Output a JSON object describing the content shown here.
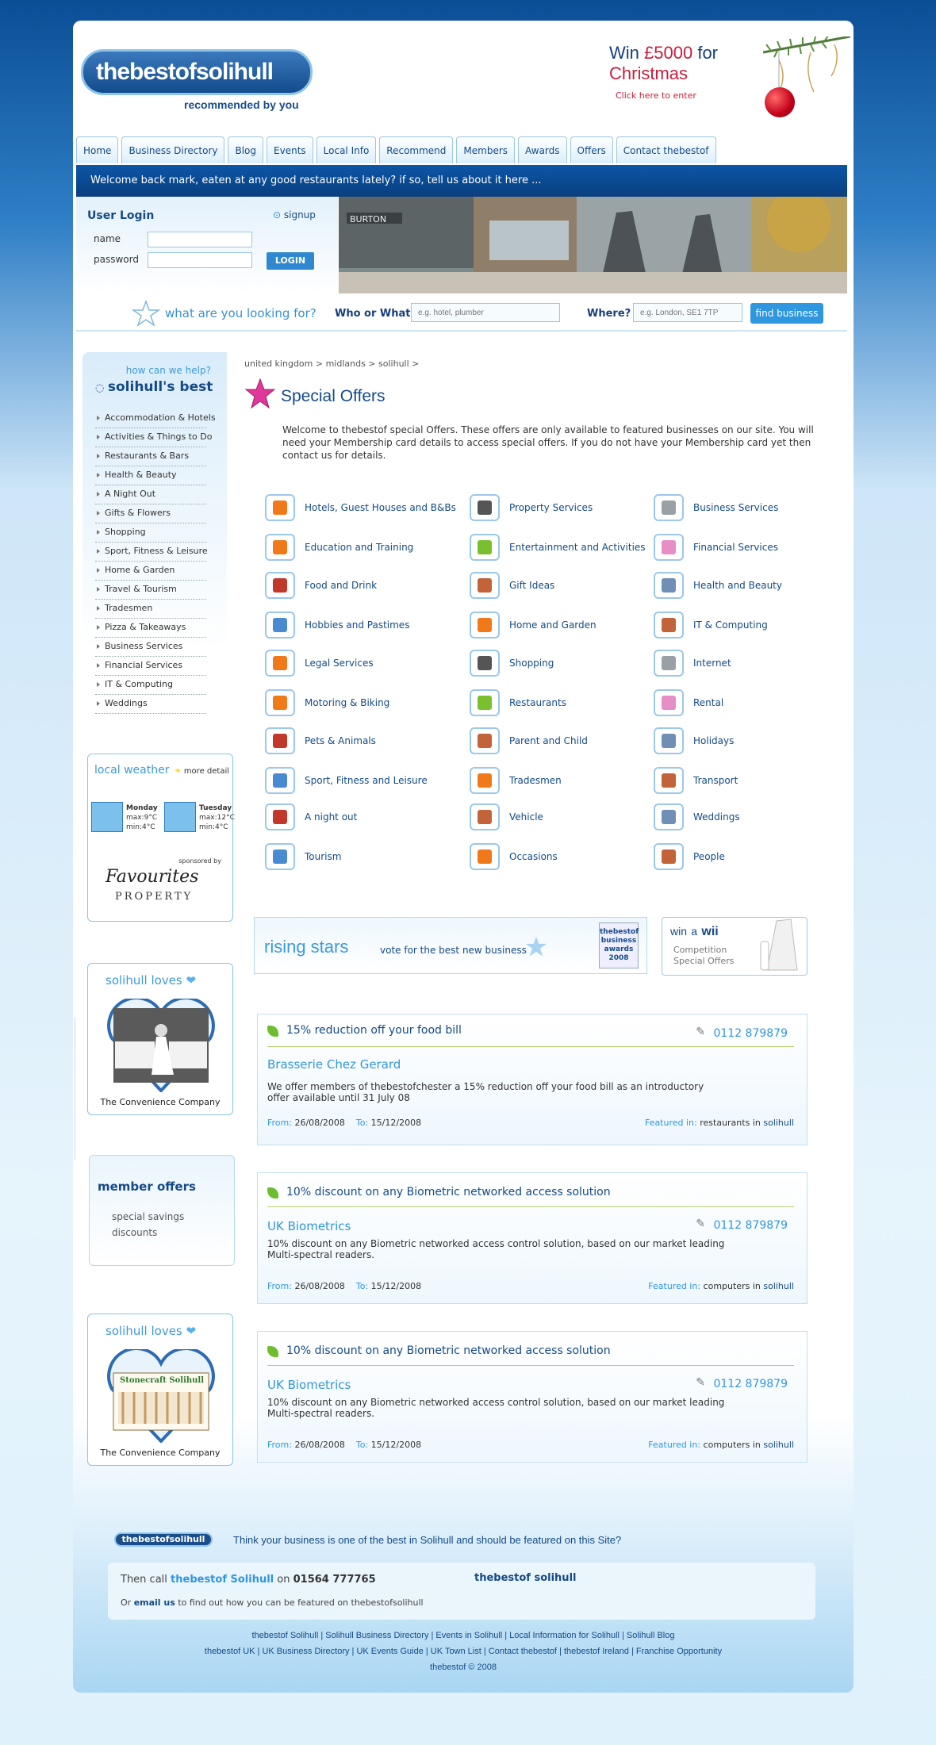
{
  "header": {
    "logo": "thebestofsolihull",
    "tagline": "recommended by you",
    "promo_line1_a": "Win",
    "promo_line1_b": "£5000",
    "promo_line1_c": "for",
    "promo_line2": "Christmas",
    "promo_link": "Click here to enter"
  },
  "nav": [
    "Home",
    "Business Directory",
    "Blog",
    "Events",
    "Local Info",
    "Recommend",
    "Members",
    "Awards",
    "Offers",
    "Contact thebestof"
  ],
  "welcome": "Welcome back mark, eaten at any good restaurants lately? if so, tell us about it here ...",
  "login": {
    "title": "User Login",
    "signup": "signup",
    "name_label": "name",
    "password_label": "password",
    "button": "LOGIN"
  },
  "search": {
    "prompt": "what are you looking for?",
    "who_label": "Who or What?",
    "who_placeholder": "e.g. hotel, plumber",
    "where_label": "Where?",
    "where_placeholder": "e.g. London, SE1 7TP",
    "button": "find business"
  },
  "sidebar": {
    "help": "how can we help?",
    "heading": "solihull's best",
    "items": [
      "Accommodation & Hotels",
      "Activities & Things to Do",
      "Restaurants & Bars",
      "Health & Beauty",
      "A Night Out",
      "Gifts & Flowers",
      "Shopping",
      "Sport, Fitness & Leisure",
      "Home & Garden",
      "Travel & Tourism",
      "Tradesmen",
      "Pizza & Takeaways",
      "Business Services",
      "Financial Services",
      "IT & Computing",
      "Weddings"
    ],
    "weather": {
      "title_a": "local",
      "title_b": "weather",
      "more": "more detail",
      "day1": "Monday",
      "day1_max": "max:9°C",
      "day1_min": "min:4°C",
      "day2": "Tuesday",
      "day2_max": "max:12°C",
      "day2_min": "min:4°C",
      "sponsored": "sponsored by",
      "sponsor_name": "Favourites",
      "sponsor_sub": "PROPERTY"
    },
    "loves1": {
      "title_a": "solihull",
      "title_b": "loves",
      "caption": "The Convenience Company"
    },
    "member": {
      "title": "member offers",
      "line1": "special savings",
      "line2": "discounts"
    },
    "loves2": {
      "title_a": "solihull",
      "title_b": "loves",
      "sign": "Stonecraft Solihull",
      "caption": "The Convenience Company"
    }
  },
  "main": {
    "breadcrumb": "united kingdom > midlands > solihull >",
    "title": "Special Offers",
    "intro": "Welcome to thebestof special Offers. These offers are only available to featured businesses on our site. You will need your Membership card details to access special offers. If you do not have your Membership card yet then contact us for details.",
    "categories": [
      {
        "label": "Hotels, Guest Houses and B&Bs",
        "icon": "bed-icon",
        "color": "#f07a1a"
      },
      {
        "label": "Property Services",
        "icon": "person-icon",
        "color": "#555555"
      },
      {
        "label": "Business Services",
        "icon": "shirt-icon",
        "color": "#9aa0a6"
      },
      {
        "label": "Education and Training",
        "icon": "mug-icon",
        "color": "#f07a1a"
      },
      {
        "label": "Entertainment and Activities",
        "icon": "dish-icon",
        "color": "#7abf2e"
      },
      {
        "label": "Financial Services",
        "icon": "lotus-icon",
        "color": "#e68fc6"
      },
      {
        "label": "Food and Drink",
        "icon": "cutlery-icon",
        "color": "#c0392b"
      },
      {
        "label": "Gift Ideas",
        "icon": "ticket-icon",
        "color": "#c2633a"
      },
      {
        "label": "Health and Beauty",
        "icon": "books-icon",
        "color": "#6f8fb5"
      },
      {
        "label": "Hobbies and Pastimes",
        "icon": "car-icon",
        "color": "#4a8ad0"
      },
      {
        "label": "Home and Garden",
        "icon": "gift-icon",
        "color": "#f07a1a"
      },
      {
        "label": "IT & Computing",
        "icon": "ticket-icon",
        "color": "#c2633a"
      },
      {
        "label": "Legal Services",
        "icon": "bed-icon",
        "color": "#f07a1a"
      },
      {
        "label": "Shopping",
        "icon": "person-icon",
        "color": "#555555"
      },
      {
        "label": "Internet",
        "icon": "shirt-icon",
        "color": "#9aa0a6"
      },
      {
        "label": "Motoring & Biking",
        "icon": "mug-icon",
        "color": "#f07a1a"
      },
      {
        "label": "Restaurants",
        "icon": "dish-icon",
        "color": "#7abf2e"
      },
      {
        "label": "Rental",
        "icon": "lotus-icon",
        "color": "#e68fc6"
      },
      {
        "label": "Pets & Animals",
        "icon": "cutlery-icon",
        "color": "#c0392b"
      },
      {
        "label": "Parent and Child",
        "icon": "ticket-icon",
        "color": "#c2633a"
      },
      {
        "label": "Holidays",
        "icon": "books-icon",
        "color": "#6f8fb5"
      },
      {
        "label": "Sport, Fitness and Leisure",
        "icon": "car-icon",
        "color": "#4a8ad0"
      },
      {
        "label": "Tradesmen",
        "icon": "gift-icon",
        "color": "#f07a1a"
      },
      {
        "label": "Transport",
        "icon": "ticket-icon",
        "color": "#c2633a"
      },
      {
        "label": "A night out",
        "icon": "cutlery-icon",
        "color": "#c0392b"
      },
      {
        "label": "Vehicle",
        "icon": "ticket-icon",
        "color": "#c2633a"
      },
      {
        "label": "Weddings",
        "icon": "books-icon",
        "color": "#6f8fb5"
      },
      {
        "label": "Tourism",
        "icon": "car-icon",
        "color": "#4a8ad0"
      },
      {
        "label": "Occasions",
        "icon": "gift-icon",
        "color": "#f07a1a"
      },
      {
        "label": "People",
        "icon": "ticket-icon",
        "color": "#c2633a"
      }
    ],
    "rising": {
      "title": "rising stars",
      "vote": "vote for the best new business",
      "badge1": "thebestof",
      "badge2": "business awards",
      "badge3": "2008"
    },
    "wii": {
      "win": "win",
      "a": "a",
      "wii": "wii",
      "line1": "Competition",
      "line2": "Special Offers"
    },
    "offers": [
      {
        "headline": "15% reduction off your food bill",
        "phone": "0112 879879",
        "business": "Brasserie Chez Gerard",
        "desc": "We offer members of thebestofchester a 15% reduction off your food bill as an introductory offer available until 31 July 08",
        "from_label": "From:",
        "from": "26/08/2008",
        "to_label": "To:",
        "to": "15/12/2008",
        "featured_label": "Featured in:",
        "category": "restaurants",
        "in": "in",
        "town": "solihull"
      },
      {
        "headline": "10% discount on any Biometric networked access solution",
        "phone": "0112 879879",
        "business": "UK Biometrics",
        "desc": "10% discount on any Biometric networked access control solution, based on our market leading Multi-spectral readers.",
        "from_label": "From:",
        "from": "26/08/2008",
        "to_label": "To:",
        "to": "15/12/2008",
        "featured_label": "Featured in:",
        "category": "computers",
        "in": "in",
        "town": "solihull"
      },
      {
        "headline": "10% discount on any Biometric networked access solution",
        "phone": "0112 879879",
        "business": "UK Biometrics",
        "desc": "10% discount on any Biometric networked access control solution, based on our market leading Multi-spectral readers.",
        "from_label": "From:",
        "from": "26/08/2008",
        "to_label": "To:",
        "to": "15/12/2008",
        "featured_label": "Featured in:",
        "category": "computers",
        "in": "in",
        "town": "solihull"
      }
    ]
  },
  "footer": {
    "logo": "thebestofsolihull",
    "tagline": "Think your business is one of the best in Solihull and should be featured on this Site?",
    "call_a": "Then call",
    "call_b": "thebestof Solihull",
    "call_c": "on",
    "call_phone": "01564 777765",
    "email_a": "Or",
    "email_link": "email us",
    "email_b": "to find out how you can be featured on thebestofsolihull",
    "brand": "thebestof solihull",
    "links1": "thebestof Solihull | Solihull Business Directory | Events in Solihull | Local Information for Solihull | Solihull Blog",
    "links2": "thebestof UK | UK Business Directory | UK Events Guide | UK Town List | Contact thebestof | thebestof Ireland | Franchise Opportunity",
    "copyright": "thebestof © 2008"
  }
}
